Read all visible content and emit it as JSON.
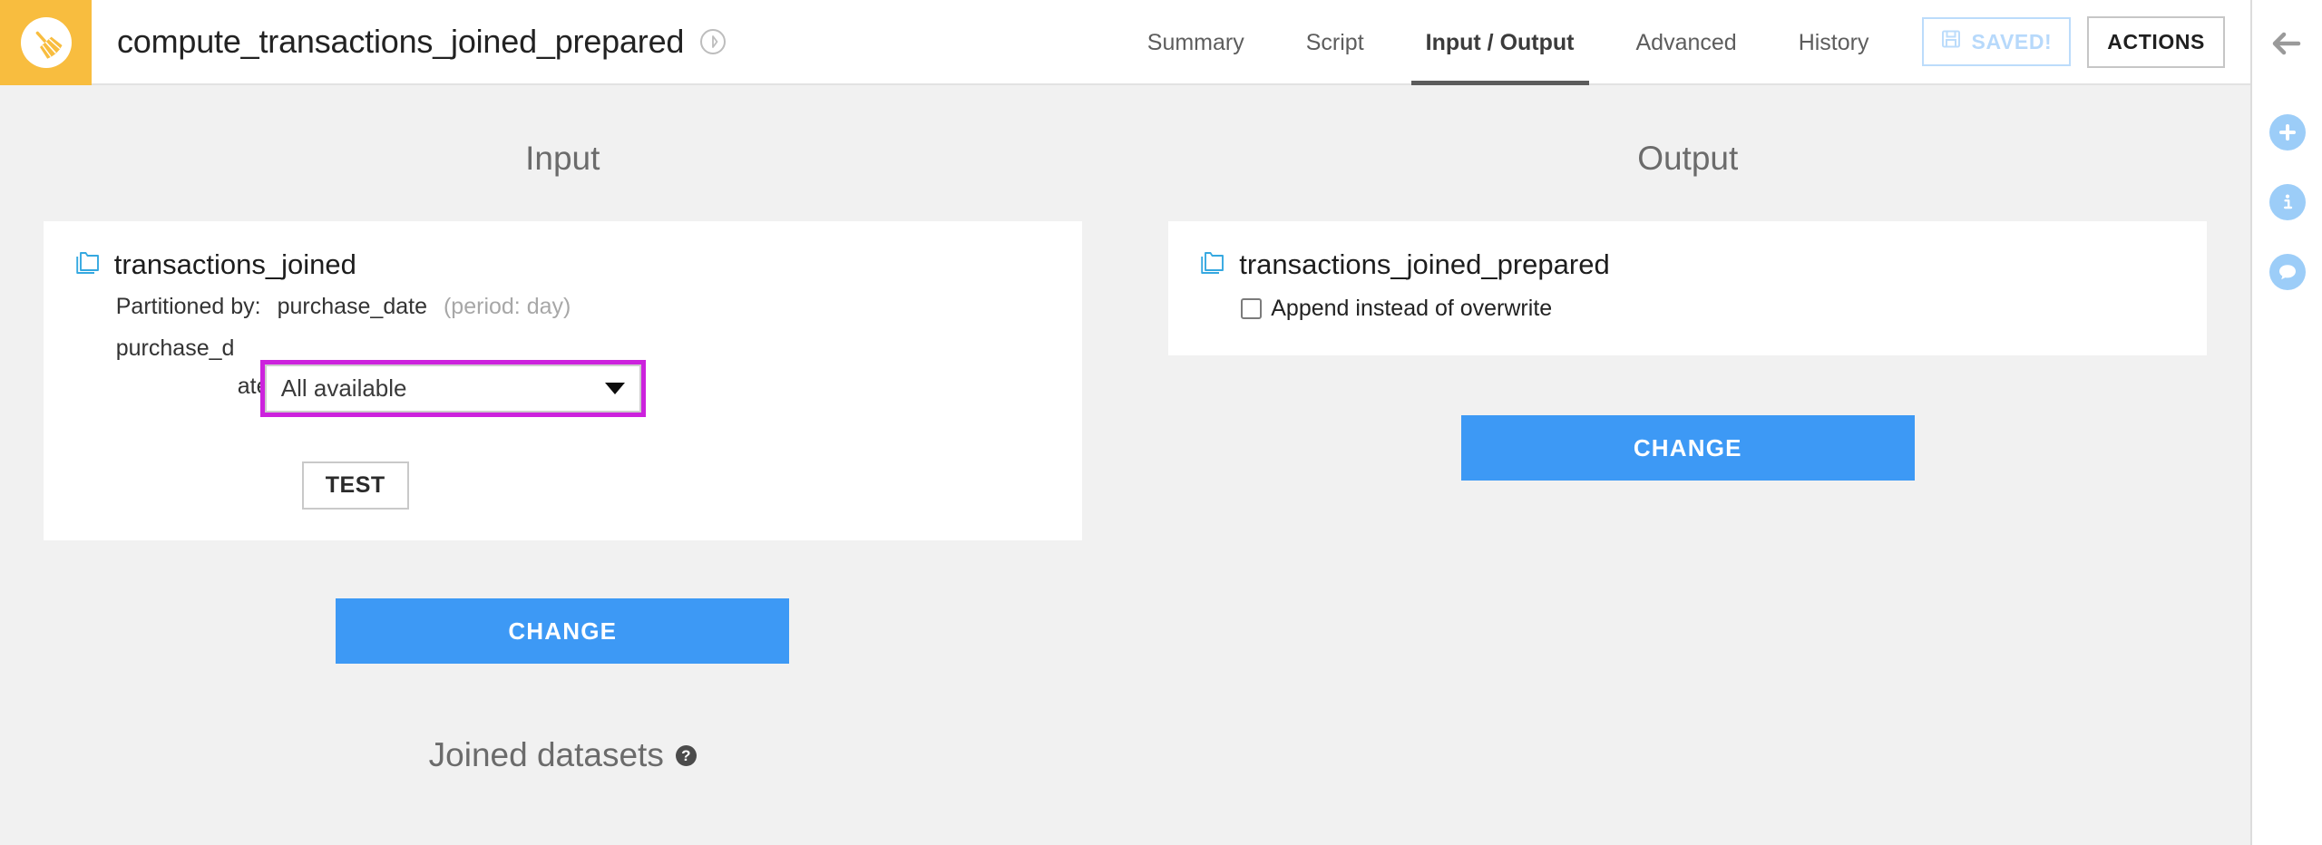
{
  "header": {
    "logo_icon": "broom-icon",
    "recipe_title": "compute_transactions_joined_prepared",
    "title_badge_icon": "prepare-recipe-icon",
    "tabs": [
      {
        "label": "Summary",
        "active": false
      },
      {
        "label": "Script",
        "active": false
      },
      {
        "label": "Input / Output",
        "active": true
      },
      {
        "label": "Advanced",
        "active": false
      },
      {
        "label": "History",
        "active": false
      }
    ],
    "saved_button": {
      "label": "SAVED!",
      "icon": "floppy-disk-icon"
    },
    "actions_button": {
      "label": "ACTIONS"
    }
  },
  "input": {
    "section_title": "Input",
    "dataset": {
      "icon": "folder-stack-icon",
      "name": "transactions_joined"
    },
    "partitioned_by_label": "Partitioned by:",
    "partitioned_by_column": "purchase_date",
    "partitioned_by_period": "(period: day)",
    "partition_label_part1": "purchase_d",
    "partition_label_part2": "ate",
    "partition_select": {
      "value": "All available",
      "caret_icon": "chevron-down-icon",
      "highlight_color": "#cc22dd"
    },
    "test_button": {
      "label": "TEST"
    },
    "change_button": {
      "label": "CHANGE"
    },
    "joined_datasets": {
      "title": "Joined datasets",
      "help_icon": "question-mark-icon",
      "help_glyph": "?"
    }
  },
  "output": {
    "section_title": "Output",
    "dataset": {
      "icon": "folder-stack-icon",
      "name": "transactions_joined_prepared"
    },
    "append_checkbox": {
      "label": "Append instead of overwrite",
      "checked": false
    },
    "change_button": {
      "label": "CHANGE"
    }
  },
  "right_sidebar": {
    "items": [
      {
        "icon": "back-arrow-icon",
        "type": "plain"
      },
      {
        "icon": "plus-icon",
        "type": "circle"
      },
      {
        "icon": "info-icon",
        "type": "circle"
      },
      {
        "icon": "comment-icon",
        "type": "circle"
      }
    ]
  },
  "colors": {
    "brand_orange": "#f8bd3f",
    "accent_blue": "#3d99f5",
    "highlight_magenta": "#cc22dd",
    "page_background": "#f1f1f1",
    "sidebar_icon_blue": "#9ccdf8"
  }
}
